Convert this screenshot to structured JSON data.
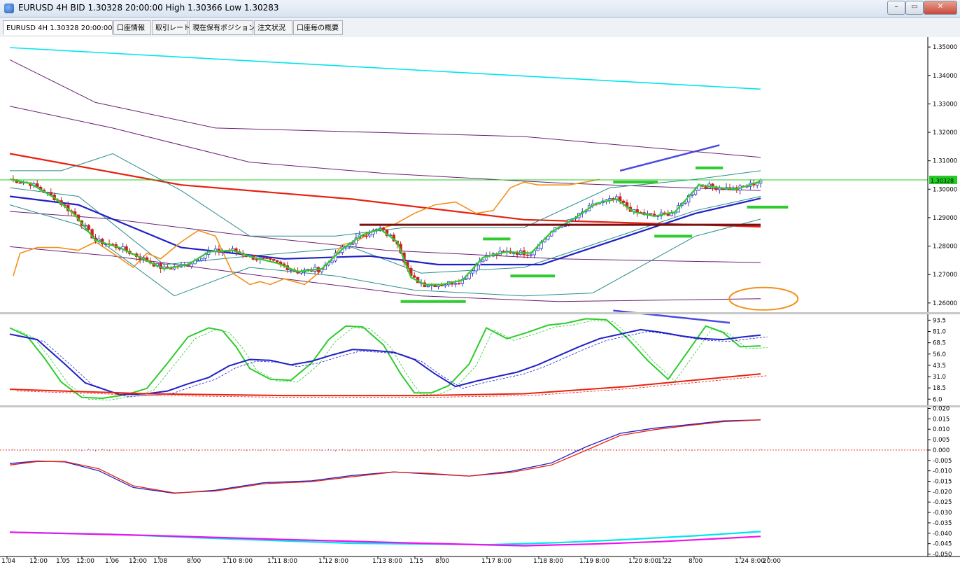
{
  "window": {
    "title": "EURUSD 4H BID 1.30328 20:00:00 High 1.30366 Low 1.30283",
    "minimize_label": "–",
    "maximize_label": "▭",
    "close_label": "✕"
  },
  "tabs": [
    {
      "label": "EURUSD 4H 1.30328 20:00:00",
      "active": true
    },
    {
      "label": "口座情報",
      "active": false
    },
    {
      "label": "取引レート",
      "active": false
    },
    {
      "label": "現在保有ポジション",
      "active": false
    },
    {
      "label": "注文状況",
      "active": false
    },
    {
      "label": "口座毎の概要",
      "active": false
    }
  ],
  "colors": {
    "candle_up": "#3333cc",
    "candle_down": "#cc2222",
    "cyan": "#00e5ee",
    "red": "#e82010",
    "purple": "#6a1f74",
    "orange": "#f39019",
    "green": "#2ecc2e",
    "blue": "#2020c8",
    "teal": "#2a8c8c",
    "darkred": "#7a1010",
    "magenta": "#ee11ee",
    "current_price": "#22cc22"
  },
  "chart_data": [
    {
      "type": "candlestick",
      "symbol": "EURUSD",
      "timeframe": "4H",
      "current_price": "1.30328",
      "ylim": [
        1.257,
        1.3525
      ],
      "y_ticks": [
        "1.35000",
        "1.34000",
        "1.33000",
        "1.32000",
        "1.31000",
        "1.30000",
        "1.29000",
        "1.28000",
        "1.27000",
        "1.26000"
      ],
      "x_labels": [
        "1.04",
        "12:00",
        "1.05",
        "12:00",
        "1.06",
        "12:00",
        "1.08",
        "8:00",
        "1.10 8:00",
        "1.11 8:00",
        "1.12 8:00",
        "1.13 8:00",
        "1.15",
        "8:00",
        "1.17 8:00",
        "1.18 8:00",
        "1.19 8:00",
        "1.20 8:00",
        "1.22",
        "8:00",
        "1.24 8:00",
        "20:00"
      ],
      "price_path": [
        [
          0,
          1.3035
        ],
        [
          6,
          1.302
        ],
        [
          13,
          1.297
        ],
        [
          19,
          1.291
        ],
        [
          25,
          1.282
        ],
        [
          32,
          1.2795
        ],
        [
          38,
          1.276
        ],
        [
          45,
          1.272
        ],
        [
          52,
          1.2735
        ],
        [
          58,
          1.278
        ],
        [
          65,
          1.2785
        ],
        [
          71,
          1.276
        ],
        [
          78,
          1.274
        ],
        [
          84,
          1.271
        ],
        [
          91,
          1.272
        ],
        [
          97,
          1.279
        ],
        [
          103,
          1.284
        ],
        [
          108,
          1.286
        ],
        [
          113,
          1.2815
        ],
        [
          117,
          1.269
        ],
        [
          121,
          1.2665
        ],
        [
          126,
          1.2665
        ],
        [
          132,
          1.268
        ],
        [
          138,
          1.276
        ],
        [
          145,
          1.278
        ],
        [
          152,
          1.2775
        ],
        [
          158,
          1.285
        ],
        [
          165,
          1.29
        ],
        [
          171,
          1.295
        ],
        [
          177,
          1.2965
        ],
        [
          182,
          1.292
        ],
        [
          188,
          1.2905
        ],
        [
          194,
          1.292
        ],
        [
          201,
          1.3015
        ],
        [
          207,
          1.3005
        ],
        [
          212,
          1.3
        ],
        [
          219,
          1.3028
        ]
      ],
      "series": [
        {
          "name": "ma-cyan",
          "x": [
            0,
            219
          ],
          "y": [
            1.3498,
            1.3352
          ]
        },
        {
          "name": "ma-red",
          "x": [
            0,
            50,
            100,
            150,
            219
          ],
          "y": [
            1.3125,
            1.3015,
            1.2965,
            1.2893,
            1.2868
          ]
        },
        {
          "name": "env-purple-1",
          "x": [
            0,
            25,
            60,
            100,
            150,
            219
          ],
          "y": [
            1.3455,
            1.3305,
            1.3215,
            1.3202,
            1.3185,
            1.3112
          ]
        },
        {
          "name": "env-purple-2",
          "x": [
            0,
            30,
            70,
            110,
            160,
            219
          ],
          "y": [
            1.3292,
            1.3215,
            1.3095,
            1.3055,
            1.3022,
            1.2995
          ]
        },
        {
          "name": "env-purple-3",
          "x": [
            0,
            30,
            70,
            110,
            160,
            219
          ],
          "y": [
            1.2922,
            1.2895,
            1.2835,
            1.2785,
            1.2755,
            1.2742
          ]
        },
        {
          "name": "env-purple-4",
          "x": [
            0,
            30,
            80,
            120,
            160,
            219
          ],
          "y": [
            1.2798,
            1.2765,
            1.2685,
            1.2625,
            1.2605,
            1.2615
          ]
        },
        {
          "name": "teal-upper",
          "x": [
            0,
            15,
            30,
            50,
            70,
            95,
            115,
            150,
            175,
            200,
            219
          ],
          "y": [
            1.3065,
            1.3065,
            1.3125,
            1.2995,
            1.2835,
            1.2835,
            1.2865,
            1.2865,
            1.3005,
            1.3035,
            1.3065
          ]
        },
        {
          "name": "teal-lower",
          "x": [
            0,
            20,
            48,
            70,
            95,
            118,
            150,
            170,
            200,
            219
          ],
          "y": [
            1.2945,
            1.2875,
            1.2625,
            1.2725,
            1.2695,
            1.2645,
            1.2625,
            1.2635,
            1.2835,
            1.2895
          ]
        },
        {
          "name": "teal-mid",
          "x": [
            0,
            20,
            45,
            70,
            100,
            120,
            150,
            170,
            200,
            219
          ],
          "y": [
            1.3005,
            1.2975,
            1.2735,
            1.2765,
            1.2795,
            1.2705,
            1.2725,
            1.2805,
            1.2925,
            1.2975
          ]
        },
        {
          "name": "ma-blue",
          "x": [
            0,
            20,
            50,
            80,
            105,
            125,
            155,
            180,
            200,
            219
          ],
          "y": [
            1.2975,
            1.2945,
            1.2795,
            1.2755,
            1.2765,
            1.2735,
            1.2735,
            1.2835,
            1.2915,
            1.2968
          ]
        },
        {
          "name": "orange-line",
          "x": [
            1,
            3,
            8,
            14,
            20,
            25,
            30,
            36,
            40,
            44,
            50,
            55,
            60,
            65,
            70,
            73,
            76,
            80,
            86,
            92,
            97,
            101,
            106,
            112,
            118,
            124,
            130,
            136,
            141,
            146,
            150,
            154,
            158,
            163,
            168,
            172
          ],
          "y": [
            1.2695,
            1.2775,
            1.2795,
            1.2795,
            1.2785,
            1.2815,
            1.2775,
            1.2725,
            1.2775,
            1.2755,
            1.2815,
            1.2855,
            1.2835,
            1.2705,
            1.2665,
            1.2675,
            1.2665,
            1.2685,
            1.2665,
            1.2725,
            1.2805,
            1.2815,
            1.2855,
            1.2875,
            1.2915,
            1.2945,
            1.2955,
            1.2915,
            1.2925,
            1.3005,
            1.3025,
            1.3015,
            1.3015,
            1.3015,
            1.3025,
            1.3035
          ]
        }
      ],
      "annotations": {
        "horizontal_level": [
          1.2875,
          102,
          219
        ],
        "green_marks": [
          [
            1,
            114,
            133,
            1.2605
          ],
          [
            2,
            138,
            146,
            1.2825
          ],
          [
            3,
            146,
            159,
            1.2695
          ],
          [
            4,
            176,
            189,
            1.3025
          ],
          [
            5,
            200,
            208,
            1.3075
          ],
          [
            6,
            188,
            199,
            1.2835
          ],
          [
            7,
            215,
            227,
            1.2937
          ]
        ],
        "blue_trendlines": [
          [
            178,
            1.3065,
            207,
            1.3155
          ],
          [
            176,
            1.2593,
            210,
            1.2555
          ]
        ],
        "orange_ellipse": [
          217,
          1.2615
        ]
      }
    },
    {
      "type": "line",
      "name": "stochastic",
      "ylim": [
        0,
        100
      ],
      "y_ticks": [
        "93.5",
        "81.0",
        "68.5",
        "56.0",
        "43.5",
        "31.0",
        "18.5",
        "6.0"
      ],
      "series": [
        {
          "name": "green",
          "x": [
            0,
            5,
            10,
            15,
            21,
            27,
            34,
            40,
            46,
            52,
            58,
            62,
            66,
            70,
            76,
            82,
            88,
            93,
            98,
            103,
            109,
            114,
            118,
            123,
            128,
            134,
            139,
            145,
            151,
            157,
            162,
            168,
            174,
            180,
            186,
            192,
            198,
            203,
            208,
            213,
            219
          ],
          "y": [
            85,
            76,
            52,
            25,
            8,
            7,
            11,
            18,
            46,
            75,
            85,
            82,
            64,
            40,
            28,
            27,
            46,
            72,
            87,
            86,
            66,
            34,
            13,
            13,
            21,
            45,
            85,
            73,
            80,
            88,
            90,
            95,
            94,
            74,
            49,
            28,
            60,
            87,
            80,
            64,
            65
          ]
        },
        {
          "name": "blue",
          "x": [
            0,
            8,
            16,
            22,
            32,
            40,
            46,
            52,
            58,
            64,
            70,
            76,
            82,
            88,
            94,
            100,
            106,
            112,
            118,
            124,
            130,
            136,
            142,
            148,
            154,
            160,
            166,
            172,
            178,
            184,
            190,
            196,
            202,
            208,
            214,
            219
          ],
          "y": [
            78,
            72,
            45,
            24,
            11,
            12,
            15,
            23,
            30,
            43,
            50,
            49,
            44,
            48,
            55,
            61,
            60,
            58,
            50,
            34,
            20,
            26,
            31,
            36,
            44,
            54,
            64,
            73,
            78,
            83,
            80,
            76,
            73,
            72,
            75,
            77
          ]
        },
        {
          "name": "red",
          "x": [
            0,
            40,
            80,
            120,
            150,
            180,
            219
          ],
          "y": [
            17,
            12,
            10,
            10,
            12,
            20,
            34
          ]
        }
      ]
    },
    {
      "type": "line",
      "name": "macd",
      "ylim": [
        -0.0505,
        0.0205
      ],
      "y_ticks": [
        "0.020",
        "0.015",
        "0.010",
        "0.005",
        "0.000",
        "-0.005",
        "-0.010",
        "-0.015",
        "-0.020",
        "-0.025",
        "-0.030",
        "-0.035",
        "-0.040",
        "-0.045",
        "-0.050"
      ],
      "series": [
        {
          "name": "blue",
          "x": [
            0,
            8,
            16,
            26,
            36,
            48,
            60,
            74,
            88,
            100,
            112,
            122,
            134,
            146,
            158,
            168,
            178,
            188,
            198,
            208,
            219
          ],
          "y": [
            -0.0065,
            -0.0053,
            -0.0057,
            -0.01,
            -0.018,
            -0.0208,
            -0.0193,
            -0.0157,
            -0.0148,
            -0.0122,
            -0.0105,
            -0.0115,
            -0.0125,
            -0.0103,
            -0.0062,
            0.0015,
            0.008,
            0.0105,
            0.0122,
            0.014,
            0.0145
          ]
        },
        {
          "name": "red",
          "x": [
            0,
            8,
            16,
            26,
            36,
            48,
            60,
            74,
            88,
            100,
            112,
            122,
            134,
            146,
            158,
            168,
            178,
            188,
            198,
            208,
            219
          ],
          "y": [
            -0.0072,
            -0.0055,
            -0.0055,
            -0.009,
            -0.0172,
            -0.0206,
            -0.0197,
            -0.0162,
            -0.0152,
            -0.0128,
            -0.0106,
            -0.0112,
            -0.0125,
            -0.0108,
            -0.0072,
            -0.0002,
            0.007,
            0.0098,
            0.0118,
            0.0136,
            0.0145
          ]
        },
        {
          "name": "cyan",
          "x": [
            0,
            30,
            60,
            100,
            140,
            160,
            180,
            200,
            219
          ],
          "y": [
            -0.0395,
            -0.0405,
            -0.0425,
            -0.0448,
            -0.0455,
            -0.0445,
            -0.043,
            -0.0412,
            -0.0392
          ]
        },
        {
          "name": "magenta",
          "x": [
            0,
            40,
            80,
            120,
            150,
            170,
            190,
            219
          ],
          "y": [
            -0.0395,
            -0.041,
            -0.043,
            -0.0448,
            -0.046,
            -0.0452,
            -0.044,
            -0.0415
          ]
        }
      ]
    }
  ]
}
